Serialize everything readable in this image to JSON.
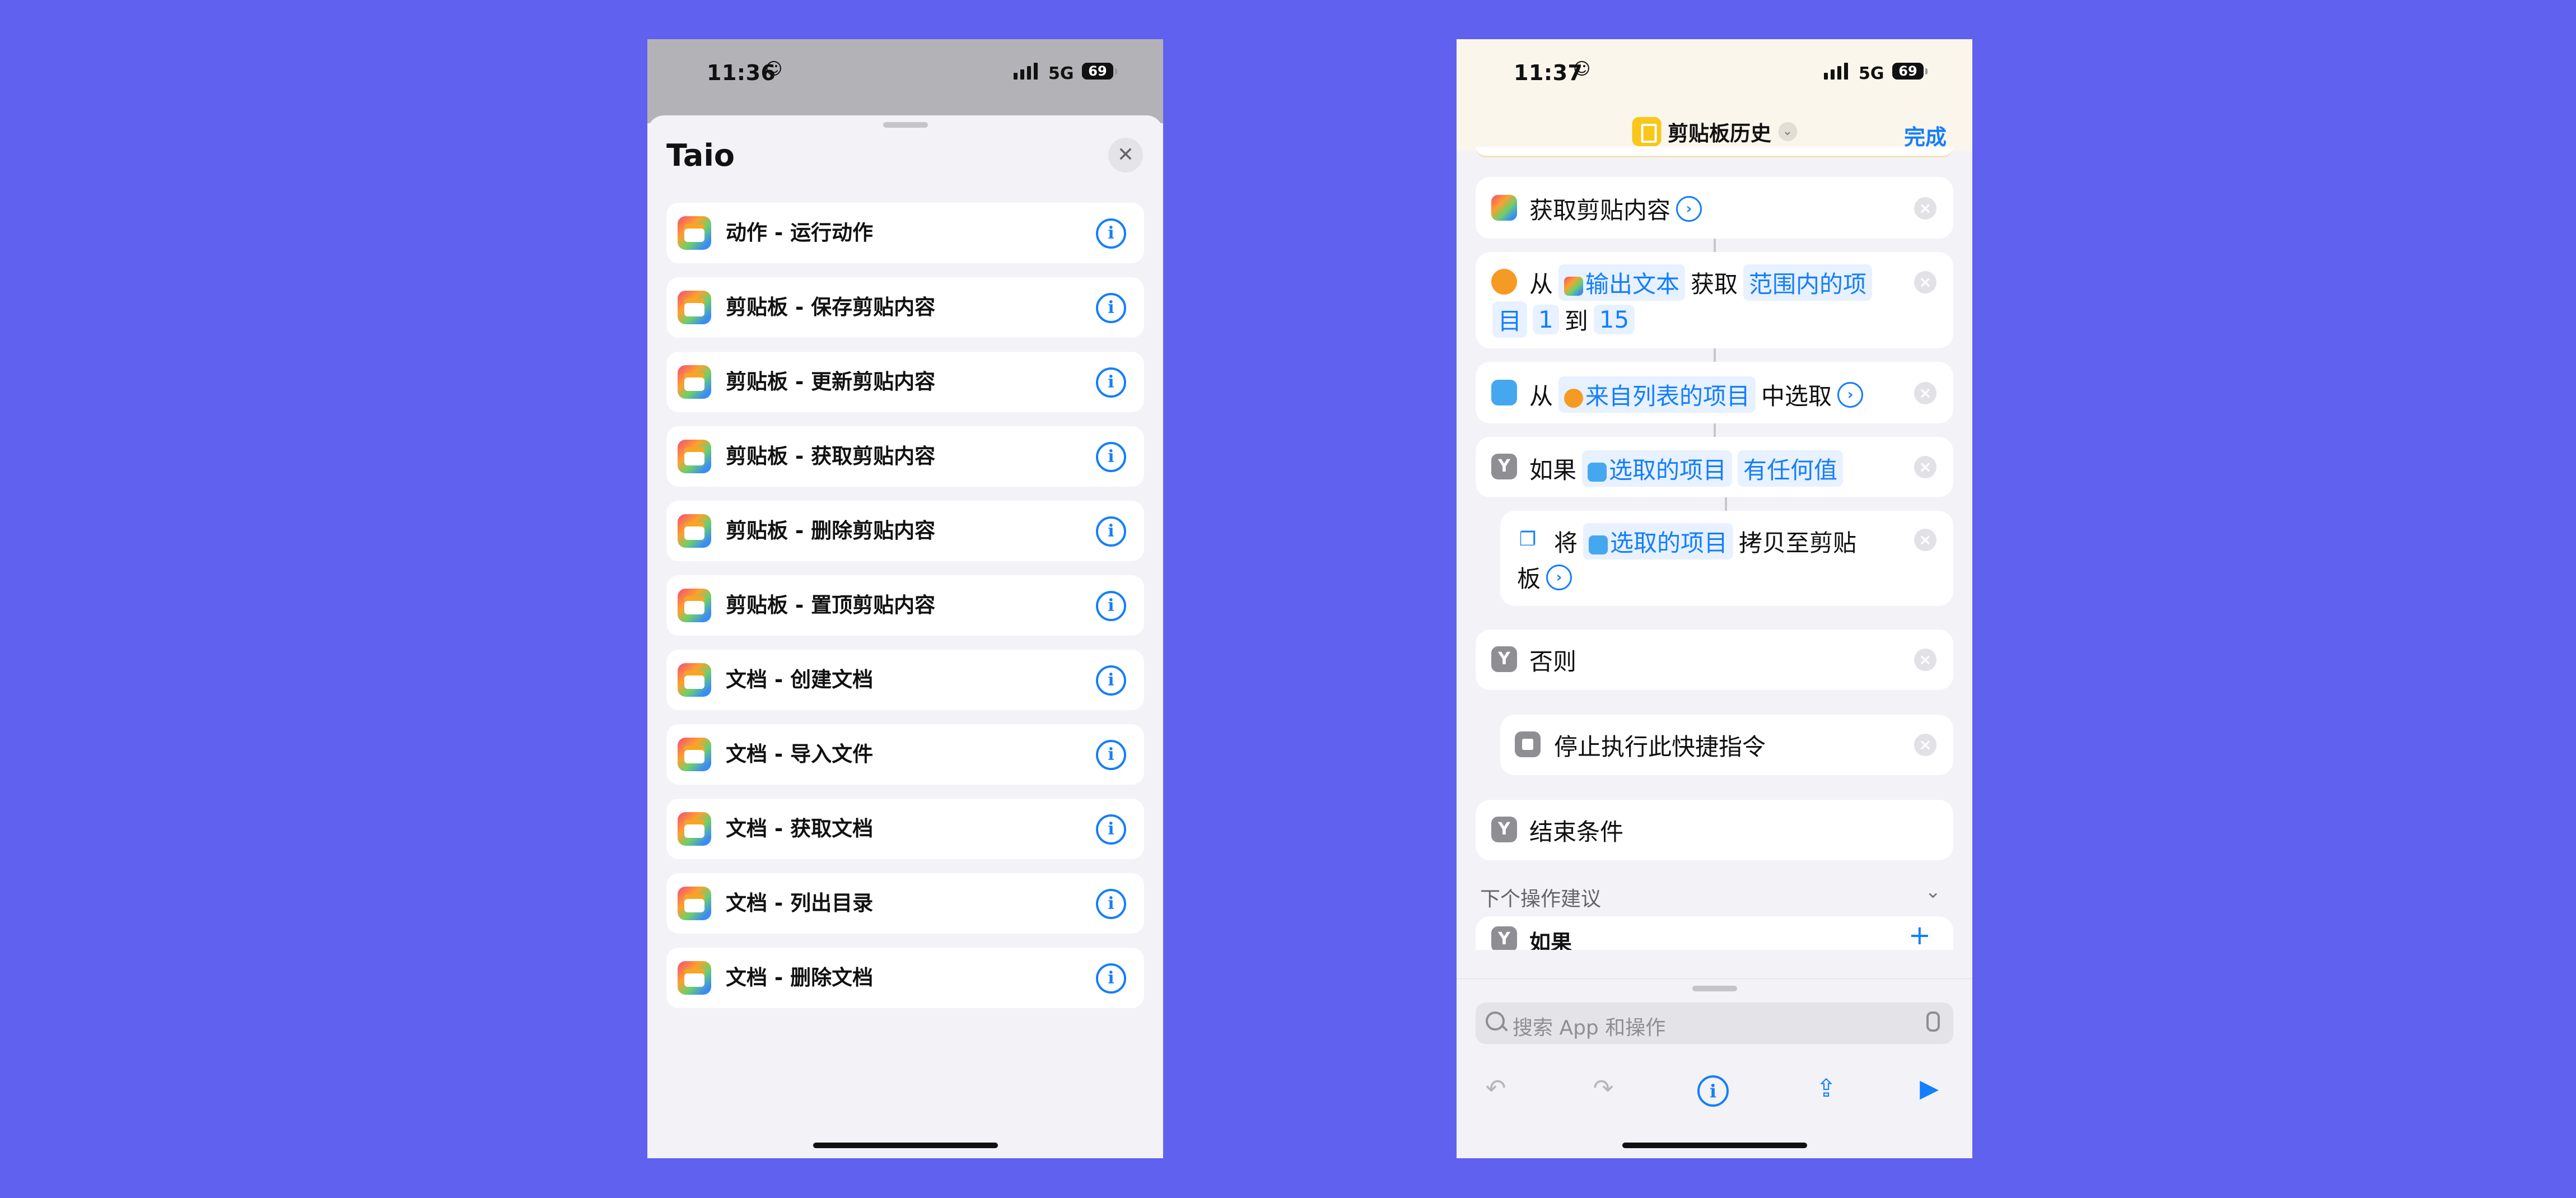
{
  "colors": {
    "background": "#6061ef",
    "accent": "#147efb",
    "nav_icon": "#f9c61a"
  },
  "left": {
    "status": {
      "time": "11:36",
      "network": "5G",
      "battery": "69"
    },
    "sheet_title": "Taio",
    "close_icon": "close-icon",
    "items": [
      {
        "label": "动作 - 运行动作"
      },
      {
        "label": "剪贴板 - 保存剪贴内容"
      },
      {
        "label": "剪贴板 - 更新剪贴内容"
      },
      {
        "label": "剪贴板 - 获取剪贴内容"
      },
      {
        "label": "剪贴板 - 删除剪贴内容"
      },
      {
        "label": "剪贴板 - 置顶剪贴内容"
      },
      {
        "label": "文档 - 创建文档"
      },
      {
        "label": "文档 - 导入文件"
      },
      {
        "label": "文档 - 获取文档"
      },
      {
        "label": "文档 - 列出目录"
      },
      {
        "label": "文档 - 删除文档"
      }
    ]
  },
  "right": {
    "status": {
      "time": "11:37",
      "network": "5G",
      "battery": "69"
    },
    "nav": {
      "title": "剪贴板历史",
      "done": "完成"
    },
    "actions": {
      "get_clipboard": "获取剪贴内容",
      "get_items": {
        "from": "从",
        "var": "输出文本",
        "get": "获取",
        "range_a": "范围内的项",
        "range_b": "目",
        "start": "1",
        "to": "到",
        "end": "15"
      },
      "choose": {
        "from": "从",
        "var": "来自列表的项目",
        "verb": "中选取"
      },
      "if": {
        "label": "如果",
        "var": "选取的项目",
        "cond": "有任何值"
      },
      "copy": {
        "verb": "将",
        "var": "选取的项目",
        "text_a": "拷贝至剪贴",
        "text_b": "板"
      },
      "otherwise": "否则",
      "stop": "停止执行此快捷指令",
      "end_if": "结束条件"
    },
    "suggestions": {
      "header": "下个操作建议",
      "first": "如果"
    },
    "search": {
      "placeholder": "搜索 App 和操作"
    }
  }
}
